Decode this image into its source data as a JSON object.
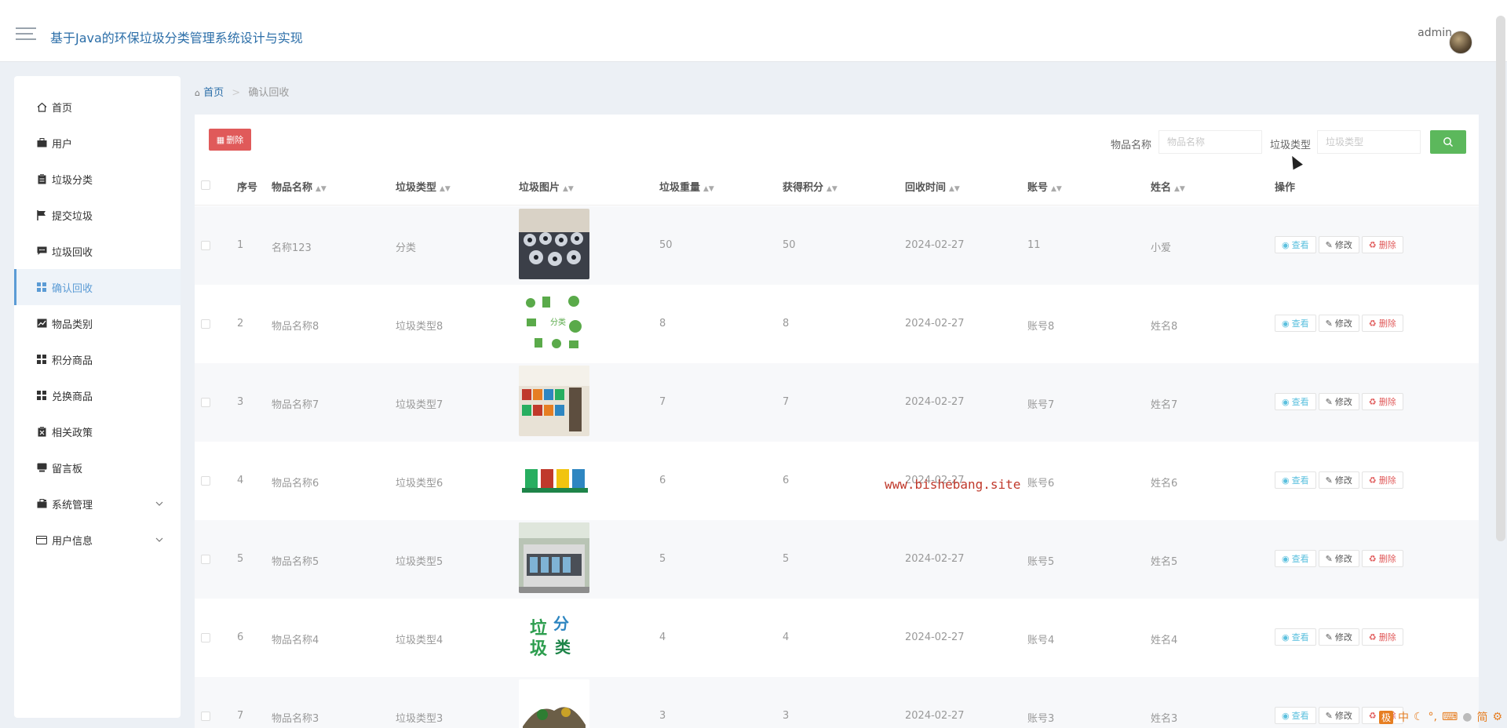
{
  "header": {
    "title": "基于Java的环保垃圾分类管理系统设计与实现",
    "user": "admin"
  },
  "sidebar": {
    "items": [
      {
        "label": "首页",
        "icon": "home-icon"
      },
      {
        "label": "用户",
        "icon": "briefcase-icon"
      },
      {
        "label": "垃圾分类",
        "icon": "clipboard-icon"
      },
      {
        "label": "提交垃圾",
        "icon": "flag-icon"
      },
      {
        "label": "垃圾回收",
        "icon": "chat-icon"
      },
      {
        "label": "确认回收",
        "icon": "grid-icon"
      },
      {
        "label": "物品类别",
        "icon": "line-chart-icon"
      },
      {
        "label": "积分商品",
        "icon": "grid-icon"
      },
      {
        "label": "兑换商品",
        "icon": "grid-icon"
      },
      {
        "label": "相关政策",
        "icon": "delete-box-icon"
      },
      {
        "label": "留言板",
        "icon": "monitor-icon"
      },
      {
        "label": "系统管理",
        "icon": "toolbox-icon"
      },
      {
        "label": "用户信息",
        "icon": "id-card-icon"
      }
    ],
    "active_index": 5
  },
  "breadcrumb": {
    "home": "首页",
    "separator": ">",
    "current": "确认回收"
  },
  "toolbar": {
    "delete_label": "删除",
    "search_name_label": "物品名称",
    "search_name_placeholder": "物品名称",
    "search_type_label": "垃圾类型",
    "search_type_placeholder": "垃圾类型"
  },
  "table": {
    "columns": [
      "序号",
      "物品名称",
      "垃圾类型",
      "垃圾图片",
      "垃圾重量",
      "获得积分",
      "回收时间",
      "账号",
      "姓名",
      "操作"
    ],
    "rows": [
      {
        "index": "1",
        "name": "名称123",
        "type": "分类",
        "weight": "50",
        "points": "50",
        "time": "2024-02-27",
        "account": "11",
        "person": "小爱",
        "image": "photo-bins-crowd"
      },
      {
        "index": "2",
        "name": "物品名称8",
        "type": "垃圾类型8",
        "weight": "8",
        "points": "8",
        "time": "2024-02-27",
        "account": "账号8",
        "person": "姓名8",
        "image": "green-poster"
      },
      {
        "index": "3",
        "name": "物品名称7",
        "type": "垃圾类型7",
        "weight": "7",
        "points": "7",
        "time": "2024-02-27",
        "account": "账号7",
        "person": "姓名7",
        "image": "sorting-station"
      },
      {
        "index": "4",
        "name": "物品名称6",
        "type": "垃圾类型6",
        "weight": "6",
        "points": "6",
        "time": "2024-02-27",
        "account": "账号6",
        "person": "姓名6",
        "image": "four-bins"
      },
      {
        "index": "5",
        "name": "物品名称5",
        "type": "垃圾类型5",
        "weight": "5",
        "points": "5",
        "time": "2024-02-27",
        "account": "账号5",
        "person": "姓名5",
        "image": "kiosk-building"
      },
      {
        "index": "6",
        "name": "物品名称4",
        "type": "垃圾类型4",
        "weight": "4",
        "points": "4",
        "time": "2024-02-27",
        "account": "账号4",
        "person": "姓名4",
        "image": "green-text-logo"
      },
      {
        "index": "7",
        "name": "物品名称3",
        "type": "垃圾类型3",
        "weight": "3",
        "points": "3",
        "time": "2024-02-27",
        "account": "账号3",
        "person": "姓名3",
        "image": "trash-pile"
      }
    ],
    "actions": {
      "view": "查看",
      "edit": "修改",
      "delete": "删除"
    }
  },
  "watermark": "www.bishebang.site",
  "tray": {
    "ime": "极",
    "lang": "中",
    "mode": "简"
  }
}
